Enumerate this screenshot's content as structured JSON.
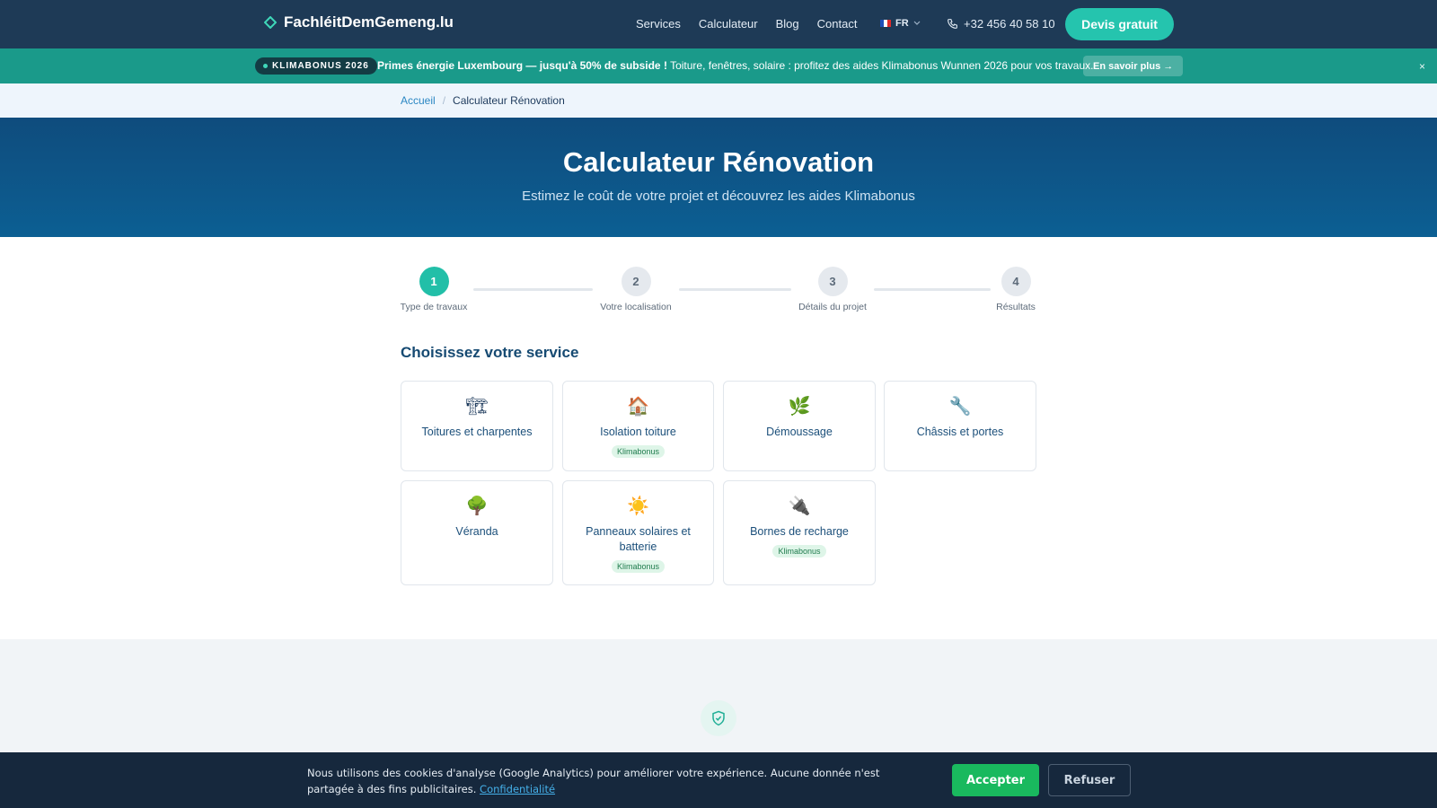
{
  "header": {
    "logo_text": "FachléitDemGemeng.lu",
    "nav": [
      "Services",
      "Calculateur",
      "Blog",
      "Contact"
    ],
    "lang": "FR",
    "phone": "+32 456 40 58 10",
    "cta": "Devis gratuit"
  },
  "promo": {
    "badge": "KLIMABONUS 2026",
    "headline": "Primes énergie Luxembourg — jusqu'à 50% de subside !",
    "body": " Toiture, fenêtres, solaire : profitez des aides Klimabonus Wunnen 2026 pour vos travaux.",
    "button": "En savoir plus →",
    "close": "×"
  },
  "breadcrumb": {
    "home": "Accueil",
    "sep": "/",
    "current": "Calculateur Rénovation"
  },
  "hero": {
    "title": "Calculateur Rénovation",
    "subtitle": "Estimez le coût de votre projet et découvrez les aides Klimabonus"
  },
  "steps": [
    {
      "num": "1",
      "label": "Type de travaux",
      "active": true
    },
    {
      "num": "2",
      "label": "Votre localisation",
      "active": false
    },
    {
      "num": "3",
      "label": "Détails du projet",
      "active": false
    },
    {
      "num": "4",
      "label": "Résultats",
      "active": false
    }
  ],
  "services": {
    "title": "Choisissez votre service",
    "items": [
      {
        "icon": "🏗",
        "label": "Toitures et charpentes",
        "tag": ""
      },
      {
        "icon": "🏠",
        "label": "Isolation toiture",
        "tag": "Klimabonus"
      },
      {
        "icon": "🌿",
        "label": "Démoussage",
        "tag": ""
      },
      {
        "icon": "🔧",
        "label": "Châssis et portes",
        "tag": ""
      },
      {
        "icon": "🌳",
        "label": "Véranda",
        "tag": ""
      },
      {
        "icon": "☀️",
        "label": "Panneaux solaires et batterie",
        "tag": "Klimabonus"
      },
      {
        "icon": "🔌",
        "label": "Bornes de recharge",
        "tag": "Klimabonus"
      }
    ]
  },
  "cookie": {
    "text": "Nous utilisons des cookies d'analyse (Google Analytics) pour améliorer votre expérience. Aucune donnée n'est partagée à des fins publicitaires. ",
    "link": "Confidentialité",
    "accept": "Accepter",
    "refuse": "Refuser"
  },
  "colors": {
    "header_bg": "#1e3a56",
    "accent_teal": "#25c4ae",
    "promo_bg": "#1a9a8a",
    "hero_bg": "#0c5f93",
    "accept_green": "#19b95e"
  }
}
